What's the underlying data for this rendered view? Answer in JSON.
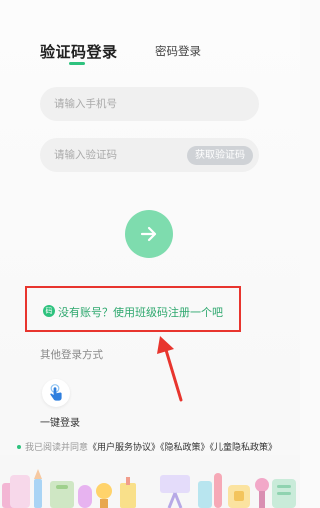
{
  "tabs": {
    "active": "验证码登录",
    "inactive": "密码登录"
  },
  "phone": {
    "placeholder": "请输入手机号"
  },
  "code": {
    "placeholder": "请输入验证码",
    "get_code_label": "获取验证码"
  },
  "submit": {
    "icon": "arrow-right-icon"
  },
  "register_hint": {
    "icon_text": "码",
    "text": "没有账号？使用班级码注册一个吧"
  },
  "other_login": {
    "title": "其他登录方式",
    "one_key_label": "一键登录",
    "one_key_icon": "tap-finger-icon"
  },
  "agreement": {
    "prefix": "我已阅读并同意",
    "user_agreement": "《用户服务协议》",
    "privacy_policy": "《隐私政策》",
    "child_privacy_policy": "《儿童隐私政策》"
  },
  "colors": {
    "accent": "#2ec27e",
    "submit_bg": "#7edcae",
    "annotation_red": "#e8352e"
  }
}
